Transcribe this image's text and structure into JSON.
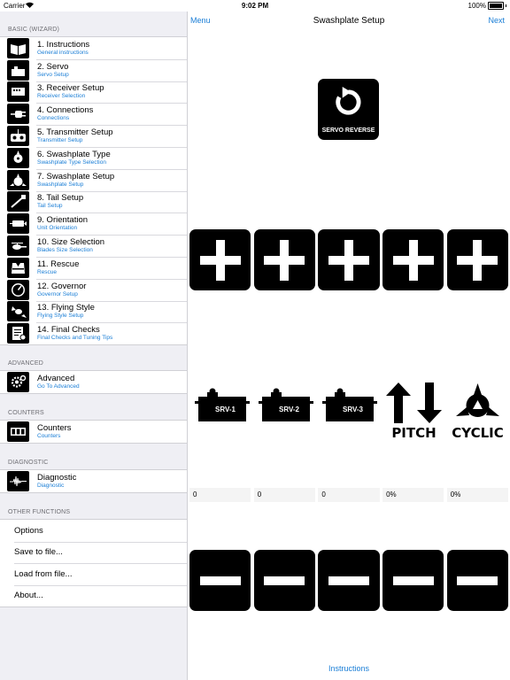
{
  "status_bar": {
    "carrier": "Carrier",
    "time": "9:02 PM",
    "battery": "100%"
  },
  "nav": {
    "left": "Menu",
    "title": "Swashplate Setup",
    "right": "Next"
  },
  "sidebar": {
    "basic_header": "BASIC (WIZARD)",
    "basic_items": [
      {
        "title": "1. Instructions",
        "subtitle": "General instructions",
        "icon": "book-icon"
      },
      {
        "title": "2. Servo",
        "subtitle": "Servo Setup",
        "icon": "servo-icon"
      },
      {
        "title": "3. Receiver Setup",
        "subtitle": "Receiver Selection",
        "icon": "receiver-icon"
      },
      {
        "title": "4. Connections",
        "subtitle": "Connections",
        "icon": "plug-icon"
      },
      {
        "title": "5. Transmitter Setup",
        "subtitle": "Transmitter Setup",
        "icon": "transmitter-icon"
      },
      {
        "title": "6. Swashplate Type",
        "subtitle": "Swashplate Type Selection",
        "icon": "swashplate-type-icon"
      },
      {
        "title": "7. Swashplate Setup",
        "subtitle": "Swashplate Setup",
        "icon": "swashplate-icon"
      },
      {
        "title": "8. Tail Setup",
        "subtitle": "Tail Setup",
        "icon": "tail-icon"
      },
      {
        "title": "9. Orientation",
        "subtitle": "Unit Orientation",
        "icon": "orientation-icon"
      },
      {
        "title": "10. Size Selection",
        "subtitle": "Blades Size Selection",
        "icon": "helicopter-size-icon"
      },
      {
        "title": "11. Rescue",
        "subtitle": "Rescue",
        "icon": "rescue-vest-icon"
      },
      {
        "title": "12. Governor",
        "subtitle": "Governor Setup",
        "icon": "gauge-icon"
      },
      {
        "title": "13. Flying Style",
        "subtitle": "Flying Style Setup",
        "icon": "flying-style-icon"
      },
      {
        "title": "14. Final Checks",
        "subtitle": "Final Checks and Tuning Tips",
        "icon": "checklist-icon"
      }
    ],
    "advanced_header": "ADVANCED",
    "advanced_item": {
      "title": "Advanced",
      "subtitle": "Go To Advanced",
      "icon": "gears-icon"
    },
    "counters_header": "COUNTERS",
    "counters_item": {
      "title": "Counters",
      "subtitle": "Counters",
      "icon": "counter-icon"
    },
    "diagnostic_header": "DIAGNOSTIC",
    "diagnostic_item": {
      "title": "Diagnostic",
      "subtitle": "Diagnostic",
      "icon": "waveform-icon"
    },
    "other_header": "OTHER FUNCTIONS",
    "other_items": [
      "Options",
      "Save to file...",
      "Load from file...",
      "About..."
    ]
  },
  "main": {
    "servo_reverse_label": "SERVO REVERSE",
    "servos": [
      "SRV-1",
      "SRV-2",
      "SRV-3"
    ],
    "pitch_label": "PITCH",
    "cyclic_label": "CYCLIC",
    "values": [
      "0",
      "0",
      "0",
      "0%",
      "0%"
    ],
    "instructions_link": "Instructions"
  }
}
